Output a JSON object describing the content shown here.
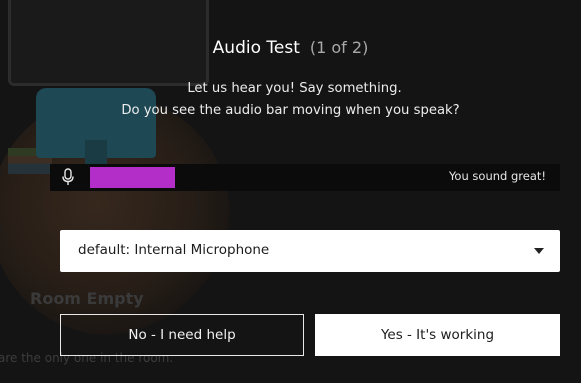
{
  "background": {
    "room_title": "Room Empty",
    "room_subtitle": "are the only one in the room."
  },
  "dialog": {
    "title": "Audio Test",
    "step": "(1 of 2)",
    "instruction_line1": "Let us hear you! Say something.",
    "instruction_line2": "Do you see the audio bar moving when you speak?",
    "meter": {
      "icon": "microphone-icon",
      "level": 0.25,
      "status": "You sound great!",
      "fill_color": "#b32ec8"
    },
    "device_select": {
      "selected": "default: Internal Microphone",
      "icon": "caret-down-icon"
    },
    "buttons": {
      "no_label": "No - I need help",
      "yes_label": "Yes - It's working"
    }
  }
}
